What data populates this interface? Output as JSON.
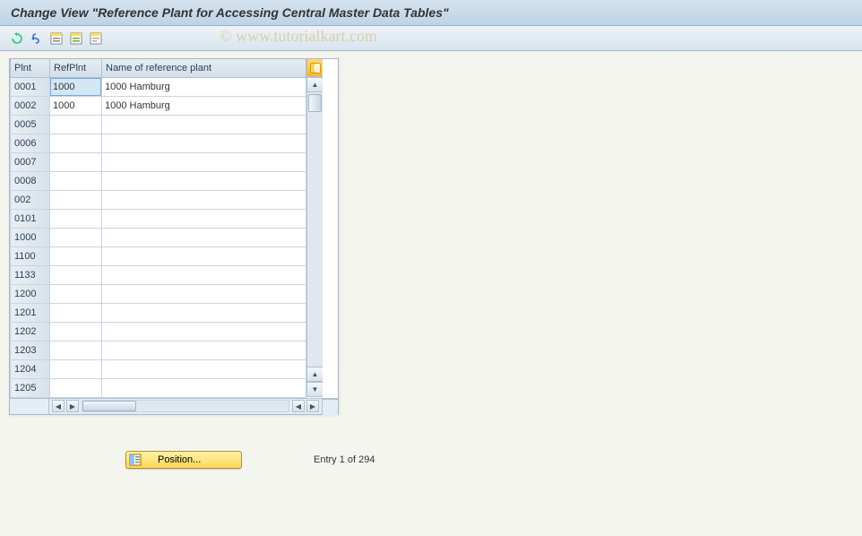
{
  "title": "Change View \"Reference Plant for Accessing Central Master Data Tables\"",
  "watermark": "© www.tutorialkart.com",
  "toolbar_icons": [
    "undo-icon",
    "other-entry-icon",
    "select-all-icon",
    "save-icon",
    "deselect-icon"
  ],
  "table": {
    "columns": {
      "plnt": "Plnt",
      "refplnt": "RefPlnt",
      "name": "Name of reference plant"
    },
    "rows": [
      {
        "plnt": "0001",
        "ref": "1000",
        "name": "1000 Hamburg",
        "selected": true
      },
      {
        "plnt": "0002",
        "ref": "1000",
        "name": "1000 Hamburg"
      },
      {
        "plnt": "0005",
        "ref": "",
        "name": ""
      },
      {
        "plnt": "0006",
        "ref": "",
        "name": ""
      },
      {
        "plnt": "0007",
        "ref": "",
        "name": ""
      },
      {
        "plnt": "0008",
        "ref": "",
        "name": ""
      },
      {
        "plnt": "002",
        "ref": "",
        "name": ""
      },
      {
        "plnt": "0101",
        "ref": "",
        "name": ""
      },
      {
        "plnt": "1000",
        "ref": "",
        "name": ""
      },
      {
        "plnt": "1100",
        "ref": "",
        "name": ""
      },
      {
        "plnt": "1133",
        "ref": "",
        "name": ""
      },
      {
        "plnt": "1200",
        "ref": "",
        "name": ""
      },
      {
        "plnt": "1201",
        "ref": "",
        "name": ""
      },
      {
        "plnt": "1202",
        "ref": "",
        "name": ""
      },
      {
        "plnt": "1203",
        "ref": "",
        "name": ""
      },
      {
        "plnt": "1204",
        "ref": "",
        "name": ""
      },
      {
        "plnt": "1205",
        "ref": "",
        "name": ""
      }
    ]
  },
  "position_button": "Position...",
  "entry_status": "Entry 1 of 294"
}
